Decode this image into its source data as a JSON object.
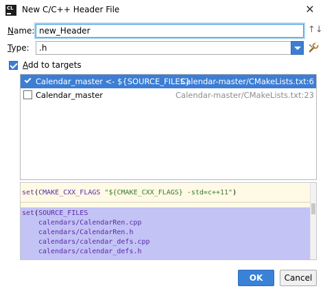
{
  "window": {
    "icon_text": "CL",
    "title": "New C/C++ Header File",
    "close_glyph": "✕"
  },
  "form": {
    "name_label_mnemonic": "N",
    "name_label_rest": "ame:",
    "name_value": "new_Header",
    "case_icon": "↑↓",
    "type_label_mnemonic": "T",
    "type_label_rest": "ype:",
    "type_value": ".h",
    "add_targets_mnemonic": "A",
    "add_targets_rest": "dd to targets",
    "add_targets_checked": true
  },
  "targets": [
    {
      "checked": true,
      "selected": true,
      "name": "Calendar_master <- ${SOURCE_FILES}",
      "path": "Calendar-master/CMakeLists.txt:6"
    },
    {
      "checked": false,
      "selected": false,
      "name": "Calendar_master",
      "path": "Calendar-master/CMakeLists.txt:23"
    }
  ],
  "code": {
    "line1": {
      "kw": "set",
      "p1": "(",
      "var": "CMAKE_CXX_FLAGS",
      "str": " \"${CMAKE_CXX_FLAGS} -std=c++11\"",
      "p2": ")"
    },
    "line2": {
      "kw": "set",
      "p1": "(",
      "var": "SOURCE_FILES"
    },
    "files": [
      "calendars/CalendarRen.cpp",
      "calendars/CalendarRen.h",
      "calendars/calendar_defs.cpp",
      "calendars/calendar_defs.h"
    ]
  },
  "buttons": {
    "ok": "OK",
    "cancel": "Cancel"
  },
  "colors": {
    "accent": "#3d7ed4",
    "code_background": "#fefae6",
    "code_highlight": "#c3c3f5"
  }
}
